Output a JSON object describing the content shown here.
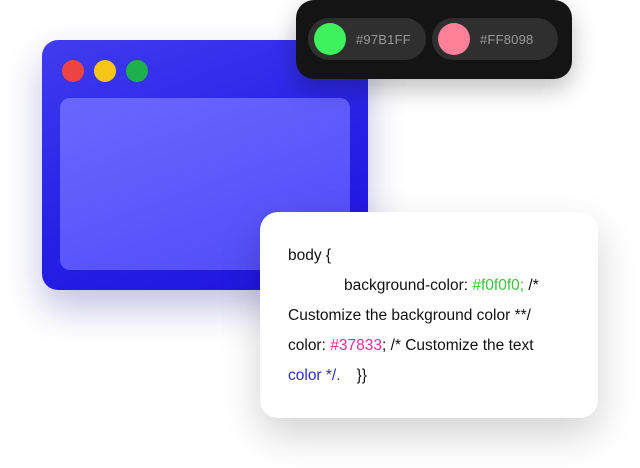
{
  "window": {
    "traffic_lights": [
      {
        "name": "close",
        "color": "#ef4444"
      },
      {
        "name": "minimize",
        "color": "#f5c518"
      },
      {
        "name": "maximize",
        "color": "#1fb04d"
      }
    ],
    "frame_color": "#2620e6",
    "viewport_color": "#5a56fb"
  },
  "palette": {
    "swatches": [
      {
        "label": "#97B1FF",
        "color": "#3df25c"
      },
      {
        "label": "#FF8098",
        "color": "#ff8098"
      }
    ]
  },
  "code": {
    "line1": "body {",
    "line2_prop": "background-color: ",
    "line2_value": "#f0f0f0;",
    "line2_comment": " /*",
    "line3": "Customize the background color **/",
    "line4_prop": "color: ",
    "line4_value": "#37833",
    "line4_comment": "; /* Customize the text",
    "line5_text": "color */.",
    "line5_close": "}}"
  }
}
